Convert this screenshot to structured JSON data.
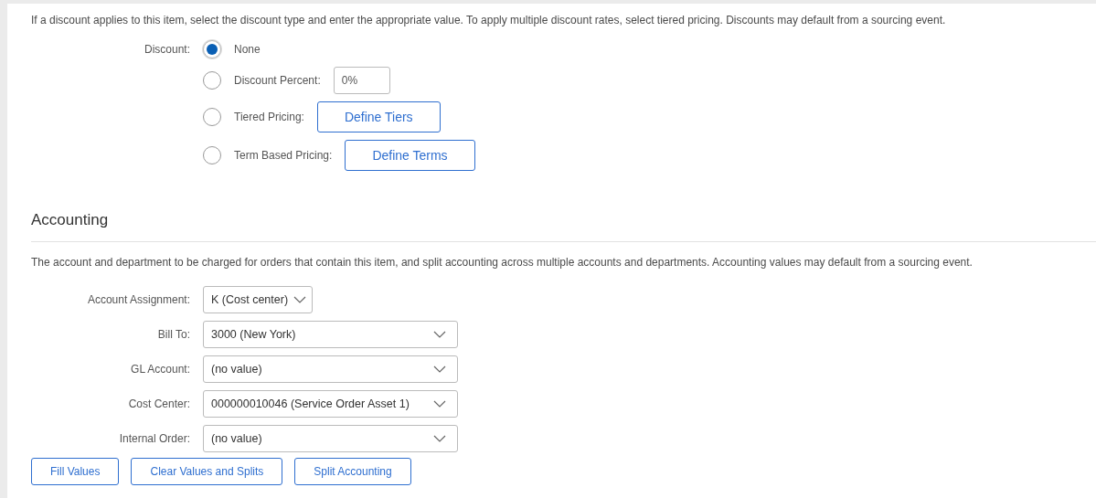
{
  "discount_section": {
    "description": "If a discount applies to this item, select the discount type and enter the appropriate value. To apply multiple discount rates, select tiered pricing. Discounts may default from a sourcing event.",
    "label": "Discount:",
    "options": [
      {
        "kind": "plain",
        "label": "None",
        "selected": true
      },
      {
        "kind": "input",
        "label": "Discount Percent:",
        "value": "0%",
        "selected": false
      },
      {
        "kind": "button",
        "label": "Tiered Pricing:",
        "button": "Define Tiers",
        "selected": false
      },
      {
        "kind": "button",
        "label": "Term Based Pricing:",
        "button": "Define Terms",
        "selected": false
      }
    ]
  },
  "accounting": {
    "title": "Accounting",
    "description": "The account and department to be charged for orders that contain this item, and split accounting across multiple accounts and departments. Accounting values may default from a sourcing event.",
    "fields": [
      {
        "kind": "compact",
        "label": "Account Assignment:",
        "value": "K (Cost center)"
      },
      {
        "kind": "wide",
        "label": "Bill To:",
        "value": "3000 (New York)"
      },
      {
        "kind": "wide",
        "label": "GL Account:",
        "value": "(no value)"
      },
      {
        "kind": "wide",
        "label": "Cost Center:",
        "value": "000000010046 (Service Order Asset 1)"
      },
      {
        "kind": "wide",
        "label": "Internal Order:",
        "value": "(no value)"
      }
    ],
    "buttons": [
      "Fill Values",
      "Clear Values and Splits",
      "Split Accounting"
    ]
  }
}
